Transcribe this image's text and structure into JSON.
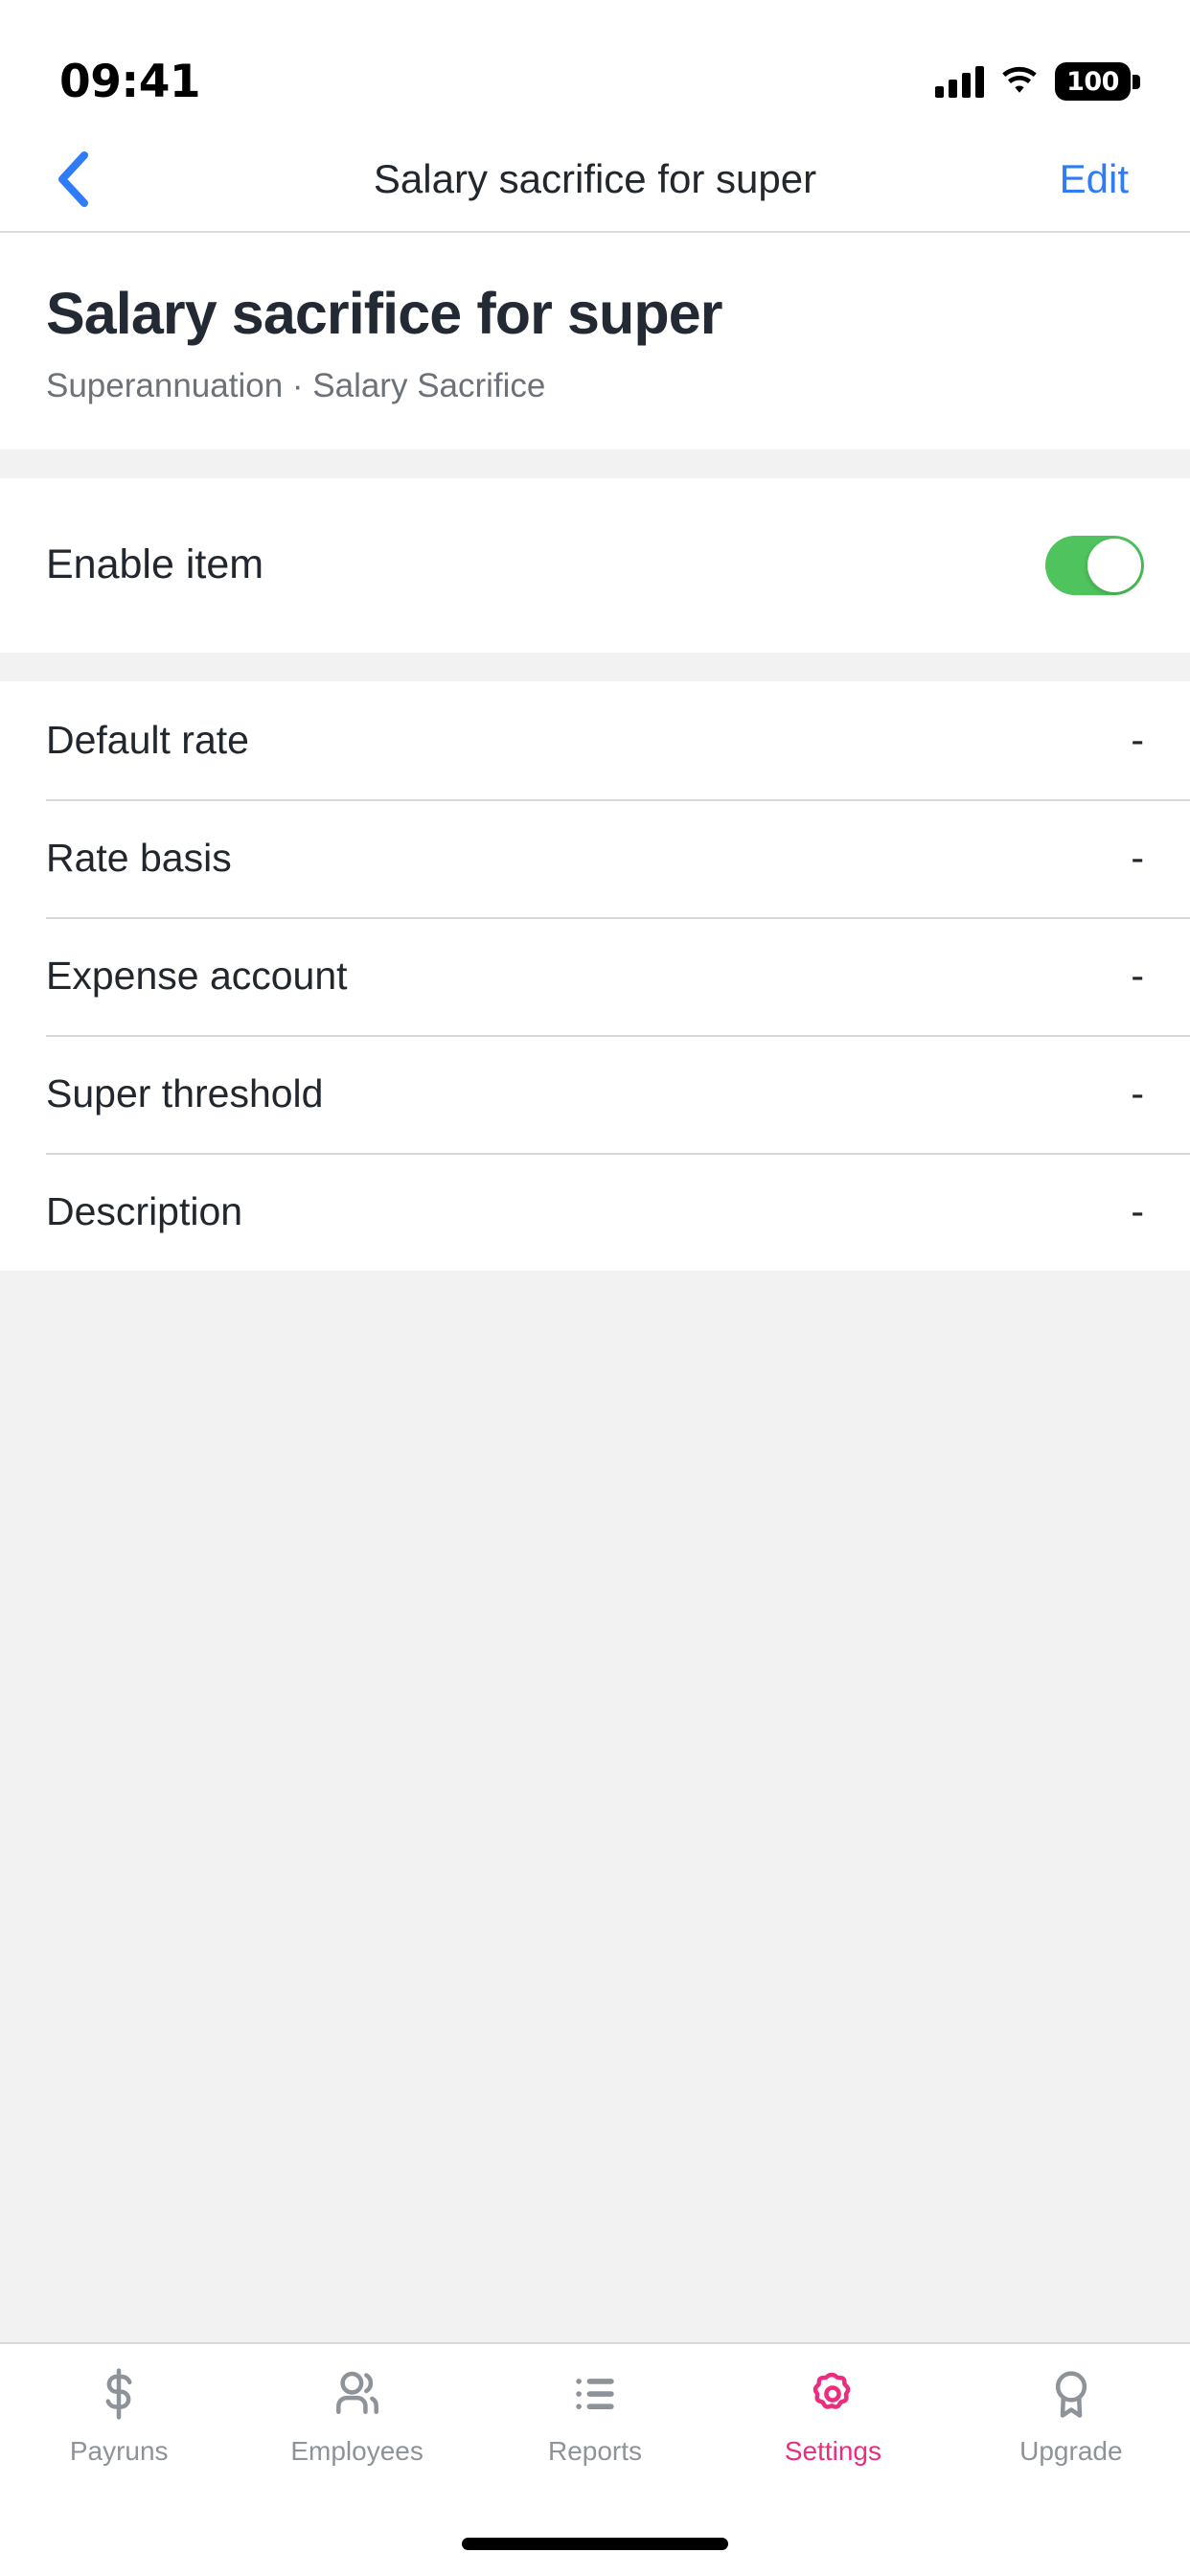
{
  "status_bar": {
    "time": "09:41",
    "signal_icon": "cellular-signal-icon",
    "wifi_icon": "wifi-icon",
    "battery_percent": "100"
  },
  "nav_bar": {
    "back_icon": "chevron-left-icon",
    "title": "Salary sacrifice for super",
    "edit_label": "Edit"
  },
  "header": {
    "title": "Salary sacrifice for super",
    "subtitle": "Superannuation · Salary Sacrifice"
  },
  "enable_section": {
    "label": "Enable item",
    "toggle_state": "on",
    "toggle_on_color": "#4fc35d"
  },
  "details": {
    "rows": [
      {
        "label": "Default rate",
        "value": "-"
      },
      {
        "label": "Rate basis",
        "value": "-"
      },
      {
        "label": "Expense account",
        "value": "-"
      },
      {
        "label": "Super threshold",
        "value": "-"
      },
      {
        "label": "Description",
        "value": "-"
      }
    ]
  },
  "tab_bar": {
    "active_color": "#ec2c7f",
    "inactive_color": "#8e9399",
    "items": [
      {
        "label": "Payruns",
        "icon": "dollar-sign-icon",
        "active": false
      },
      {
        "label": "Employees",
        "icon": "people-icon",
        "active": false
      },
      {
        "label": "Reports",
        "icon": "list-icon",
        "active": false
      },
      {
        "label": "Settings",
        "icon": "gear-icon",
        "active": true
      },
      {
        "label": "Upgrade",
        "icon": "award-ribbon-icon",
        "active": false
      }
    ]
  }
}
